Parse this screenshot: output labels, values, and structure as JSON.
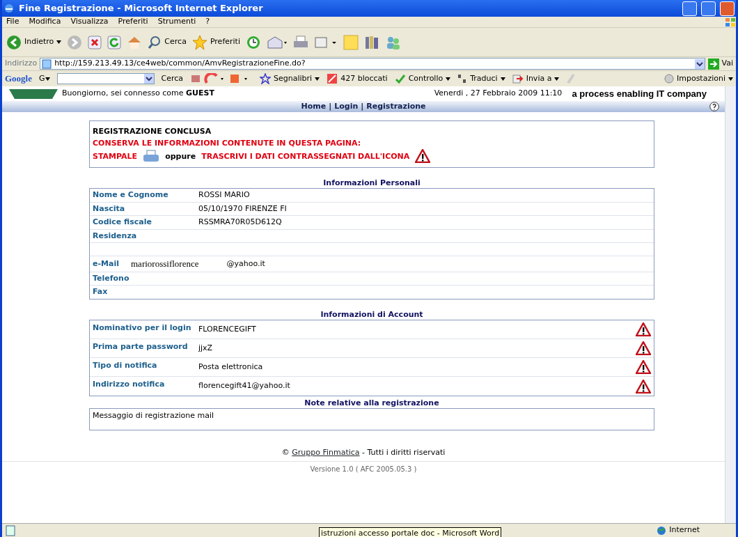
{
  "window": {
    "title": "Fine Registrazione - Microsoft Internet Explorer"
  },
  "menu": [
    "File",
    "Modifica",
    "Visualizza",
    "Preferiti",
    "Strumenti",
    "?"
  ],
  "toolbar": {
    "back": "Indietro",
    "search": "Cerca",
    "favorites": "Preferiti"
  },
  "address": {
    "label": "Indirizzo",
    "url": "http://159.213.49.13/ce4web/common/AmvRegistrazioneFine.do?",
    "go": "Vai"
  },
  "google_bar": {
    "logo": "Google",
    "g": "G",
    "search": "Cerca",
    "bookmarks": "Segnalibri",
    "blocked": "427 bloccati",
    "check": "Controllo",
    "translate": "Traduci",
    "send": "Invia a",
    "settings": "Impostazioni"
  },
  "header": {
    "greeting": "Buongiorno, sei connesso come ",
    "user": "GUEST",
    "date": "Venerdi , 27 Febbraio 2009 11:10",
    "slogan": "a process enabling IT company"
  },
  "nav": [
    "Home",
    "Login",
    "Registrazione"
  ],
  "nav_separator": "|",
  "alert": {
    "title": "REGISTRAZIONE CONCLUSA",
    "line": "CONSERVA LE INFORMAZIONI CONTENUTE IN QUESTA PAGINA:",
    "print": "STAMPALE",
    "or": "oppure",
    "transcribe": "TRASCRIVI I DATI CONTRASSEGNATI DALL'ICONA"
  },
  "personal": {
    "title": "Informazioni Personali",
    "rows": [
      {
        "label": "Nome e Cognome",
        "value": "ROSSI MARIO"
      },
      {
        "label": "Nascita",
        "value": "05/10/1970 FIRENZE FI"
      },
      {
        "label": "Codice fiscale",
        "value": "RSSMRA70R05D612Q"
      },
      {
        "label": "Residenza"
      },
      {},
      {
        "label": "e-Mail",
        "value": "mariorossiflorence",
        "domain": "@yahoo.it"
      },
      {
        "label": "Telefono"
      },
      {
        "label": "Fax"
      }
    ]
  },
  "account": {
    "title": "Informazioni di Account",
    "rows": [
      {
        "label": "Nominativo per il login",
        "value": "FLORENCEGIFT",
        "warning": true
      },
      {
        "label": "Prima parte password",
        "value": "jjxZ",
        "warning": true
      },
      {
        "label": "Tipo di notifica",
        "value": "Posta elettronica",
        "warning": true
      },
      {
        "label": "Indirizzo notifica",
        "value": "florencegift41@yahoo.it",
        "warning": true
      }
    ]
  },
  "notes": {
    "title": "Note relative alla registrazione",
    "text": "Messaggio di registrazione mail"
  },
  "footer": {
    "copyright": "©",
    "link": "Gruppo Finmatica",
    "rights": "- Tutti i diritti riservati",
    "version": "Versione 1.0  ( AFC 2005.05.3 )"
  },
  "status_bar": {
    "zone": "Internet",
    "tooltip": "istruzioni accesso portale doc - Microsoft Word"
  }
}
